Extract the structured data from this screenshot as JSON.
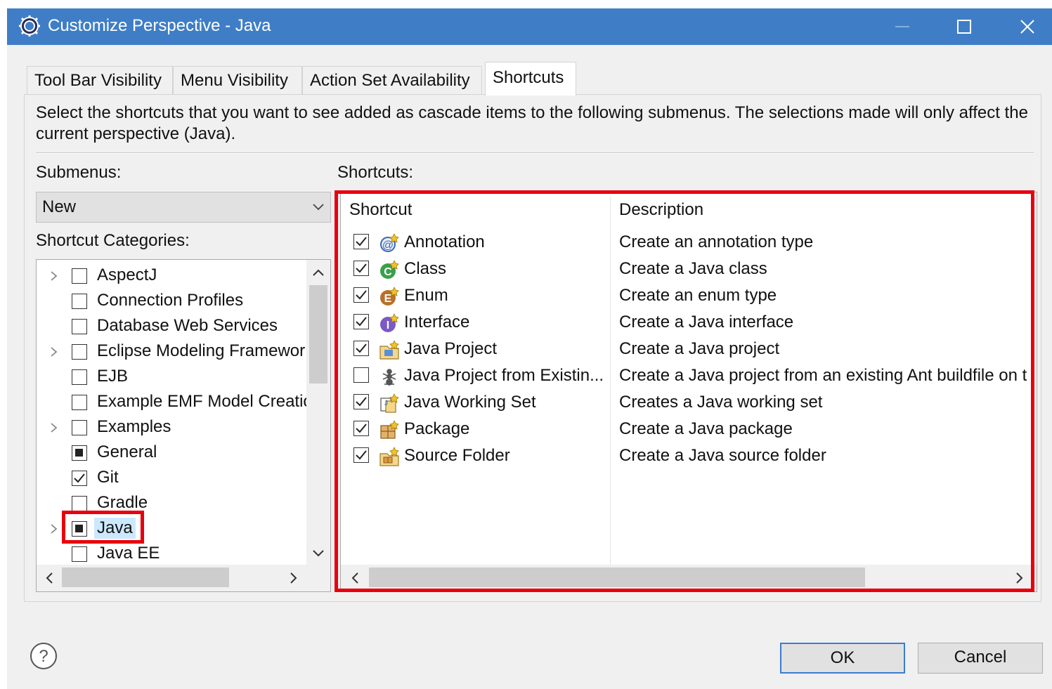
{
  "window": {
    "title": "Customize Perspective - Java",
    "icon": "eclipse-gear-icon",
    "titlebar_color": "#3f7ec7"
  },
  "tabs": [
    {
      "label": "Tool Bar Visibility",
      "active": false
    },
    {
      "label": "Menu Visibility",
      "active": false
    },
    {
      "label": "Action Set Availability",
      "active": false
    },
    {
      "label": "Shortcuts",
      "active": true
    }
  ],
  "description": "Select the shortcuts that you want to see added as cascade items to the following submenus.  The selections made will only affect the current perspective (Java).",
  "submenus": {
    "label": "Submenus:",
    "selected": "New"
  },
  "categories": {
    "label": "Shortcut Categories:",
    "items": [
      {
        "label": "AspectJ",
        "state": "unchecked",
        "expandable": true
      },
      {
        "label": "Connection Profiles",
        "state": "unchecked",
        "expandable": false
      },
      {
        "label": "Database Web Services",
        "state": "unchecked",
        "expandable": false
      },
      {
        "label": "Eclipse Modeling Framewor",
        "state": "unchecked",
        "expandable": true
      },
      {
        "label": "EJB",
        "state": "unchecked",
        "expandable": false
      },
      {
        "label": "Example EMF Model Creatio",
        "state": "unchecked",
        "expandable": false
      },
      {
        "label": "Examples",
        "state": "unchecked",
        "expandable": true
      },
      {
        "label": "General",
        "state": "partial",
        "expandable": false
      },
      {
        "label": "Git",
        "state": "checked",
        "expandable": false
      },
      {
        "label": "Gradle",
        "state": "unchecked",
        "expandable": false
      },
      {
        "label": "Java",
        "state": "partial",
        "expandable": true,
        "selected": true
      },
      {
        "label": "Java EE",
        "state": "unchecked",
        "expandable": false
      }
    ]
  },
  "shortcuts": {
    "label": "Shortcuts:",
    "columns": [
      "Shortcut",
      "Description"
    ],
    "rows": [
      {
        "name": "Annotation",
        "description": "Create an annotation type",
        "checked": true,
        "icon": "annotation-icon"
      },
      {
        "name": "Class",
        "description": "Create a Java class",
        "checked": true,
        "icon": "class-icon"
      },
      {
        "name": "Enum",
        "description": "Create an enum type",
        "checked": true,
        "icon": "enum-icon"
      },
      {
        "name": "Interface",
        "description": "Create a Java interface",
        "checked": true,
        "icon": "interface-icon"
      },
      {
        "name": "Java Project",
        "description": "Create a Java project",
        "checked": true,
        "icon": "java-project-icon"
      },
      {
        "name": "Java Project from Existin...",
        "description": "Create a Java project from an existing Ant buildfile on t",
        "checked": false,
        "icon": "ant-project-icon"
      },
      {
        "name": "Java Working Set",
        "description": "Creates a Java working set",
        "checked": true,
        "icon": "working-set-icon"
      },
      {
        "name": "Package",
        "description": "Create a Java package",
        "checked": true,
        "icon": "package-icon"
      },
      {
        "name": "Source Folder",
        "description": "Create a Java source folder",
        "checked": true,
        "icon": "source-folder-icon"
      }
    ]
  },
  "buttons": {
    "ok": "OK",
    "cancel": "Cancel",
    "help_icon": "help-icon"
  },
  "highlight_color": "#e8000b"
}
